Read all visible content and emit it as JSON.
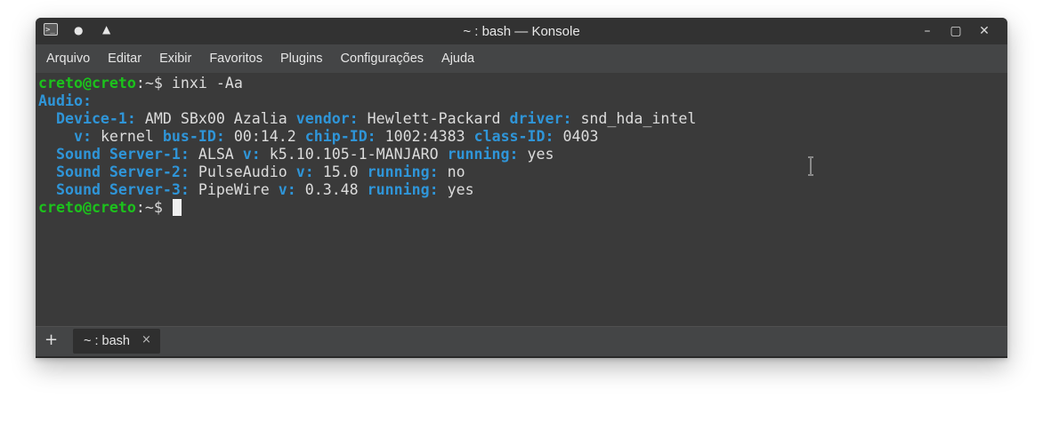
{
  "window": {
    "title": "~ : bash — Konsole"
  },
  "menubar": {
    "items": [
      "Arquivo",
      "Editar",
      "Exibir",
      "Favoritos",
      "Plugins",
      "Configurações",
      "Ajuda"
    ]
  },
  "terminal": {
    "prompt_user_host": "creto@creto",
    "prompt_path": ":~$",
    "command": " inxi -Aa",
    "output": {
      "audio_header": "Audio:",
      "l1_k1": "  Device-1:",
      "l1_v1": " AMD SBx00 Azalia ",
      "l1_k2": "vendor:",
      "l1_v2": " Hewlett-Packard ",
      "l1_k3": "driver:",
      "l1_v3": " snd_hda_intel",
      "l2_k1": "    v:",
      "l2_v1": " kernel ",
      "l2_k2": "bus-ID:",
      "l2_v2": " 00:14.2 ",
      "l2_k3": "chip-ID:",
      "l2_v3": " 1002:4383 ",
      "l2_k4": "class-ID:",
      "l2_v4": " 0403",
      "l3_k1": "  Sound Server-1:",
      "l3_v1": " ALSA ",
      "l3_k2": "v:",
      "l3_v2": " k5.10.105-1-MANJARO ",
      "l3_k3": "running:",
      "l3_v3": " yes",
      "l4_k1": "  Sound Server-2:",
      "l4_v1": " PulseAudio ",
      "l4_k2": "v:",
      "l4_v2": " 15.0 ",
      "l4_k3": "running:",
      "l4_v3": " no",
      "l5_k1": "  Sound Server-3:",
      "l5_v1": " PipeWire ",
      "l5_k2": "v:",
      "l5_v2": " 0.3.48 ",
      "l5_k3": "running:",
      "l5_v3": " yes"
    }
  },
  "tabs": {
    "new_tab_glyph": "+",
    "items": [
      {
        "label": "~ : bash",
        "close_glyph": "×"
      }
    ]
  },
  "colors": {
    "prompt_green": "#1cc21c",
    "key_blue": "#2f95d8",
    "terminal_bg": "#3a3a3a",
    "menubar_bg": "#444546"
  },
  "icons": {
    "app": "terminal-icon",
    "pin": "dot-icon",
    "keep_above": "triangle-up-icon",
    "minimize": "minimize-icon",
    "maximize": "maximize-icon",
    "close": "close-icon",
    "cursor": "text-cursor-icon"
  }
}
